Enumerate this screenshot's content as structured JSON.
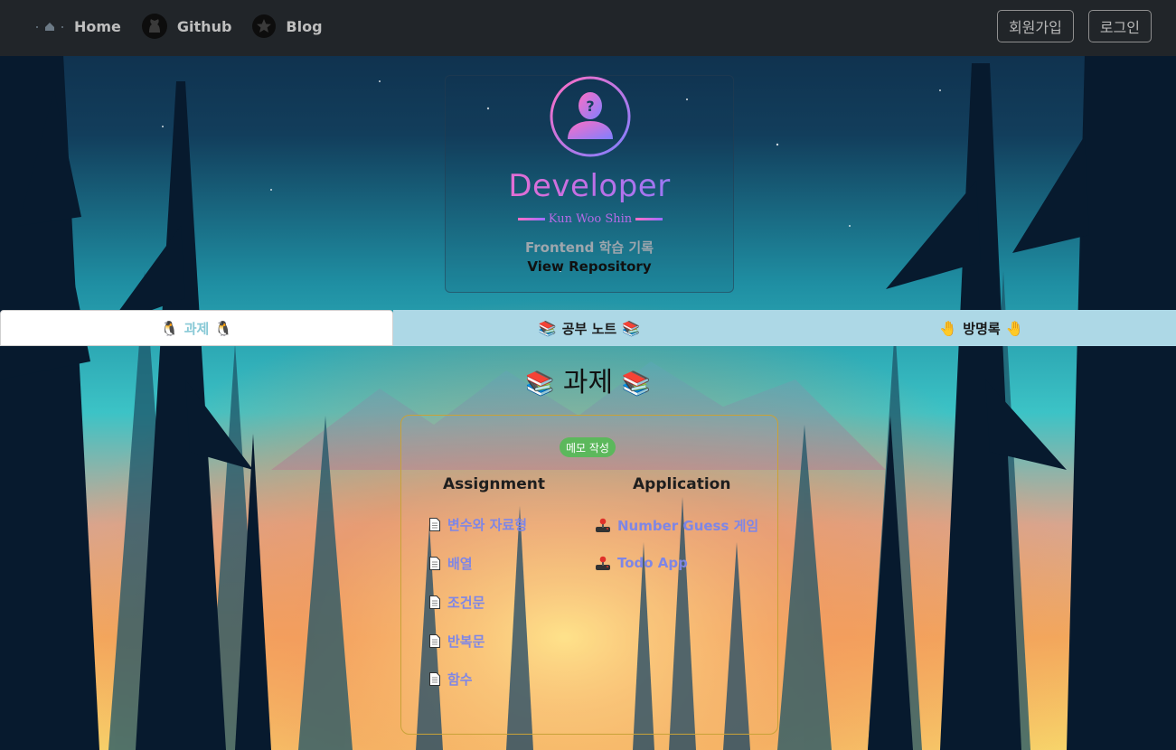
{
  "nav": {
    "home_icon_text": "·  ·",
    "home": "Home",
    "github": "Github",
    "blog": "Blog",
    "signup": "회원가입",
    "login": "로그인"
  },
  "profile": {
    "title": "Developer",
    "name": "Kun Woo Shin",
    "description": "Frontend 학습 기록",
    "link": "View Repository"
  },
  "tabs": [
    {
      "label": "과제",
      "emoji": "🐧"
    },
    {
      "label": "공부 노트",
      "emoji": "📚"
    },
    {
      "label": "방명록",
      "emoji": "🤚"
    }
  ],
  "section": {
    "title": "과제",
    "title_emoji": "📚",
    "memo_badge": "메모 작성",
    "assignment_header": "Assignment",
    "application_header": "Application",
    "assignments": [
      "변수와 자료형",
      "배열",
      "조건문",
      "반복문",
      "함수"
    ],
    "applications": [
      "Number Guess 게임",
      "Todo App"
    ]
  },
  "colors": {
    "navbar": "#212529",
    "tab_bg": "#add8e6",
    "link": "#7e86e6",
    "badge": "#5cb85c",
    "card_border": "#c8a238",
    "title_gradient_start": "#ff6ec4",
    "title_gradient_end": "#7f7fff"
  },
  "icons": {
    "home": "home-icon",
    "github": "github-icon",
    "blog": "star-icon",
    "avatar": "unknown-user-icon",
    "document": "document-icon",
    "application": "joystick-icon"
  }
}
